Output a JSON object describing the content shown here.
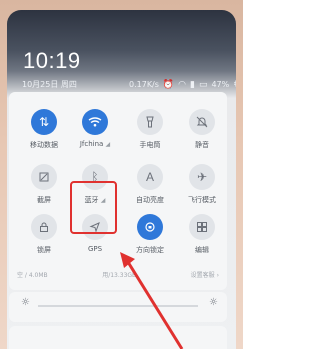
{
  "status": {
    "time": "10:19",
    "date": "10月25日 周四",
    "speed": "0.17K/s",
    "battery": "47%"
  },
  "tiles": [
    {
      "id": "mobile-data",
      "label": "移动数据",
      "sub": "",
      "active": true,
      "icon": "↑↓"
    },
    {
      "id": "wifi",
      "label": "Jfchina",
      "sub": "◢",
      "active": true,
      "icon": "wifi"
    },
    {
      "id": "flashlight",
      "label": "手电筒",
      "sub": "",
      "active": false,
      "icon": "flashlight"
    },
    {
      "id": "silent",
      "label": "静音",
      "sub": "",
      "active": false,
      "icon": "bell-off"
    },
    {
      "id": "screenshot",
      "label": "截屏",
      "sub": "",
      "active": false,
      "icon": "scissors"
    },
    {
      "id": "bluetooth",
      "label": "蓝牙",
      "sub": "◢",
      "active": false,
      "icon": "bluetooth"
    },
    {
      "id": "auto-brightness",
      "label": "自动亮度",
      "sub": "",
      "active": false,
      "icon": "A"
    },
    {
      "id": "airplane",
      "label": "飞行模式",
      "sub": "",
      "active": false,
      "icon": "airplane"
    },
    {
      "id": "lock",
      "label": "锁屏",
      "sub": "",
      "active": false,
      "icon": "lock"
    },
    {
      "id": "gps",
      "label": "GPS",
      "sub": "",
      "active": false,
      "icon": "arrow"
    },
    {
      "id": "rotation-lock",
      "label": "方向锁定",
      "sub": "",
      "active": true,
      "icon": "rotate"
    },
    {
      "id": "edit",
      "label": "编辑",
      "sub": "",
      "active": false,
      "icon": "edit"
    }
  ],
  "storage": {
    "left": "空 / 4.0MB",
    "middle": "用/13.33GB",
    "right": "设置客服 ›"
  },
  "colors": {
    "accent": "#2f78d9",
    "highlight": "#e0312f"
  }
}
